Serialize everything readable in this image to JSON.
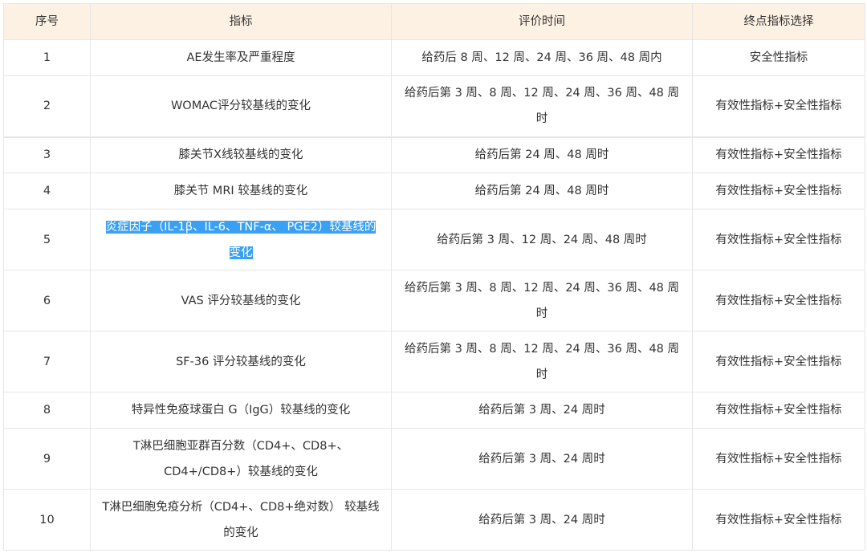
{
  "table": {
    "headers": [
      "序号",
      "指标",
      "评价时间",
      "终点指标选择"
    ],
    "rows": [
      {
        "no": "1",
        "indicator": "AE发生率及严重程度",
        "time": "给药后 8 周、12 周、24 周、36 周、48 周内",
        "endpoint": "安全性指标"
      },
      {
        "no": "2",
        "indicator": "WOMAC评分较基线的变化",
        "time": "给药后第 3 周、8 周、12 周、24 周、36 周、48 周时",
        "endpoint": "有效性指标+安全性指标"
      },
      {
        "no": "3",
        "indicator": "膝关节X线较基线的变化",
        "time": "给药后第 24 周、48 周时",
        "endpoint": "有效性指标+安全性指标"
      },
      {
        "no": "4",
        "indicator": "膝关节 MRI 较基线的变化",
        "time": "给药后第 24 周、48 周时",
        "endpoint": "有效性指标+安全性指标"
      },
      {
        "no": "5",
        "indicator": "炎症因子（IL-1β、IL-6、TNF-α、 PGE2）较基线的变化",
        "time": "给药后第 3 周、12 周、24 周、48 周时",
        "endpoint": "有效性指标+安全性指标"
      },
      {
        "no": "6",
        "indicator": "VAS 评分较基线的变化",
        "time": "给药后第 3 周、8 周、12 周、24 周、36 周、48 周时",
        "endpoint": "有效性指标+安全性指标"
      },
      {
        "no": "7",
        "indicator": "SF-36 评分较基线的变化",
        "time": "给药后第 3 周、8 周、12 周、24 周、36 周、48 周时",
        "endpoint": "有效性指标+安全性指标"
      },
      {
        "no": "8",
        "indicator": "特异性免疫球蛋白 G（IgG）较基线的变化",
        "time": "给药后第 3 周、24 周时",
        "endpoint": "有效性指标+安全性指标"
      },
      {
        "no": "9",
        "indicator": "T淋巴细胞亚群百分数（CD4+、CD8+、CD4+/CD8+）较基线的变化",
        "time": "给药后第 3 周、24 周时",
        "endpoint": "有效性指标+安全性指标"
      },
      {
        "no": "10",
        "indicator": "T淋巴细胞免疫分析（CD4+、CD8+绝对数） 较基线的变化",
        "time": "给药后第 3 周、24 周时",
        "endpoint": "有效性指标+安全性指标"
      }
    ]
  },
  "selection": {
    "row": "5",
    "color": "#3aa0f3"
  },
  "colors": {
    "header_bg": "#fdf1e4",
    "border": "#e6e6e6",
    "text": "#333333"
  }
}
